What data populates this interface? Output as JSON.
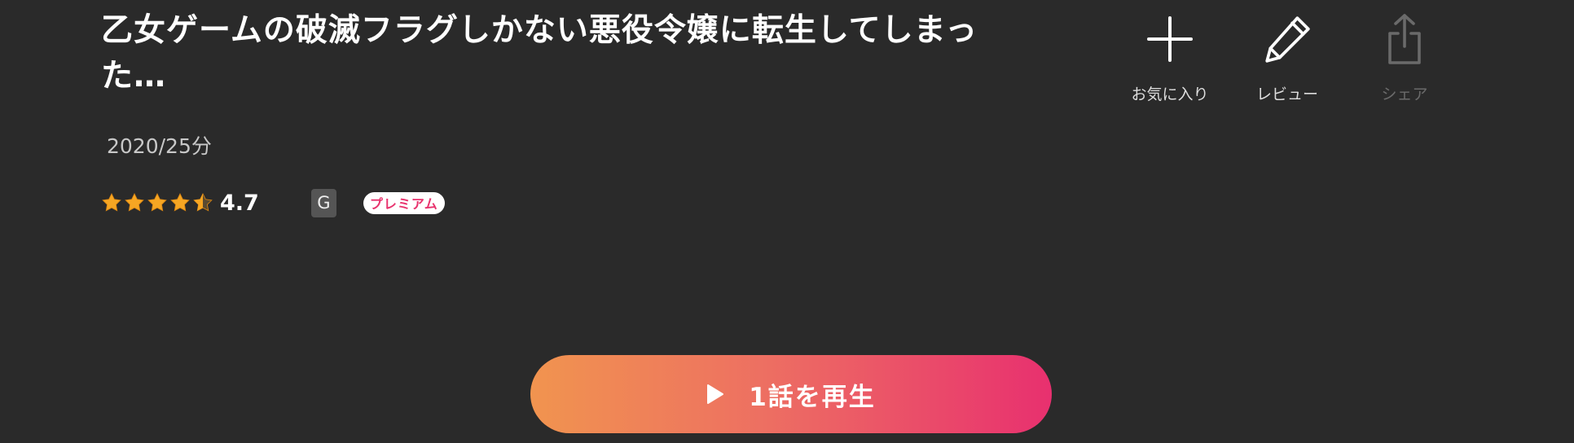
{
  "title": "乙女ゲームの破滅フラグしかない悪役令嬢に転生してしまった…",
  "meta": "2020/25分",
  "rating": {
    "value": "4.7",
    "stars": 4.5,
    "star_color": "#f6a623"
  },
  "age_rating": "G",
  "premium_label": "プレミアム",
  "actions": {
    "favorite": {
      "label": "お気に入り",
      "icon": "plus-icon"
    },
    "review": {
      "label": "レビュー",
      "icon": "pencil-icon"
    },
    "share": {
      "label": "シェア",
      "icon": "share-icon",
      "disabled": true
    }
  },
  "play_button": {
    "label": "1話を再生",
    "icon": "play-icon",
    "gradient": [
      "#f1944f",
      "#e8306f"
    ]
  },
  "colors": {
    "background": "#2a2a2a",
    "accent": "#e8336e"
  }
}
